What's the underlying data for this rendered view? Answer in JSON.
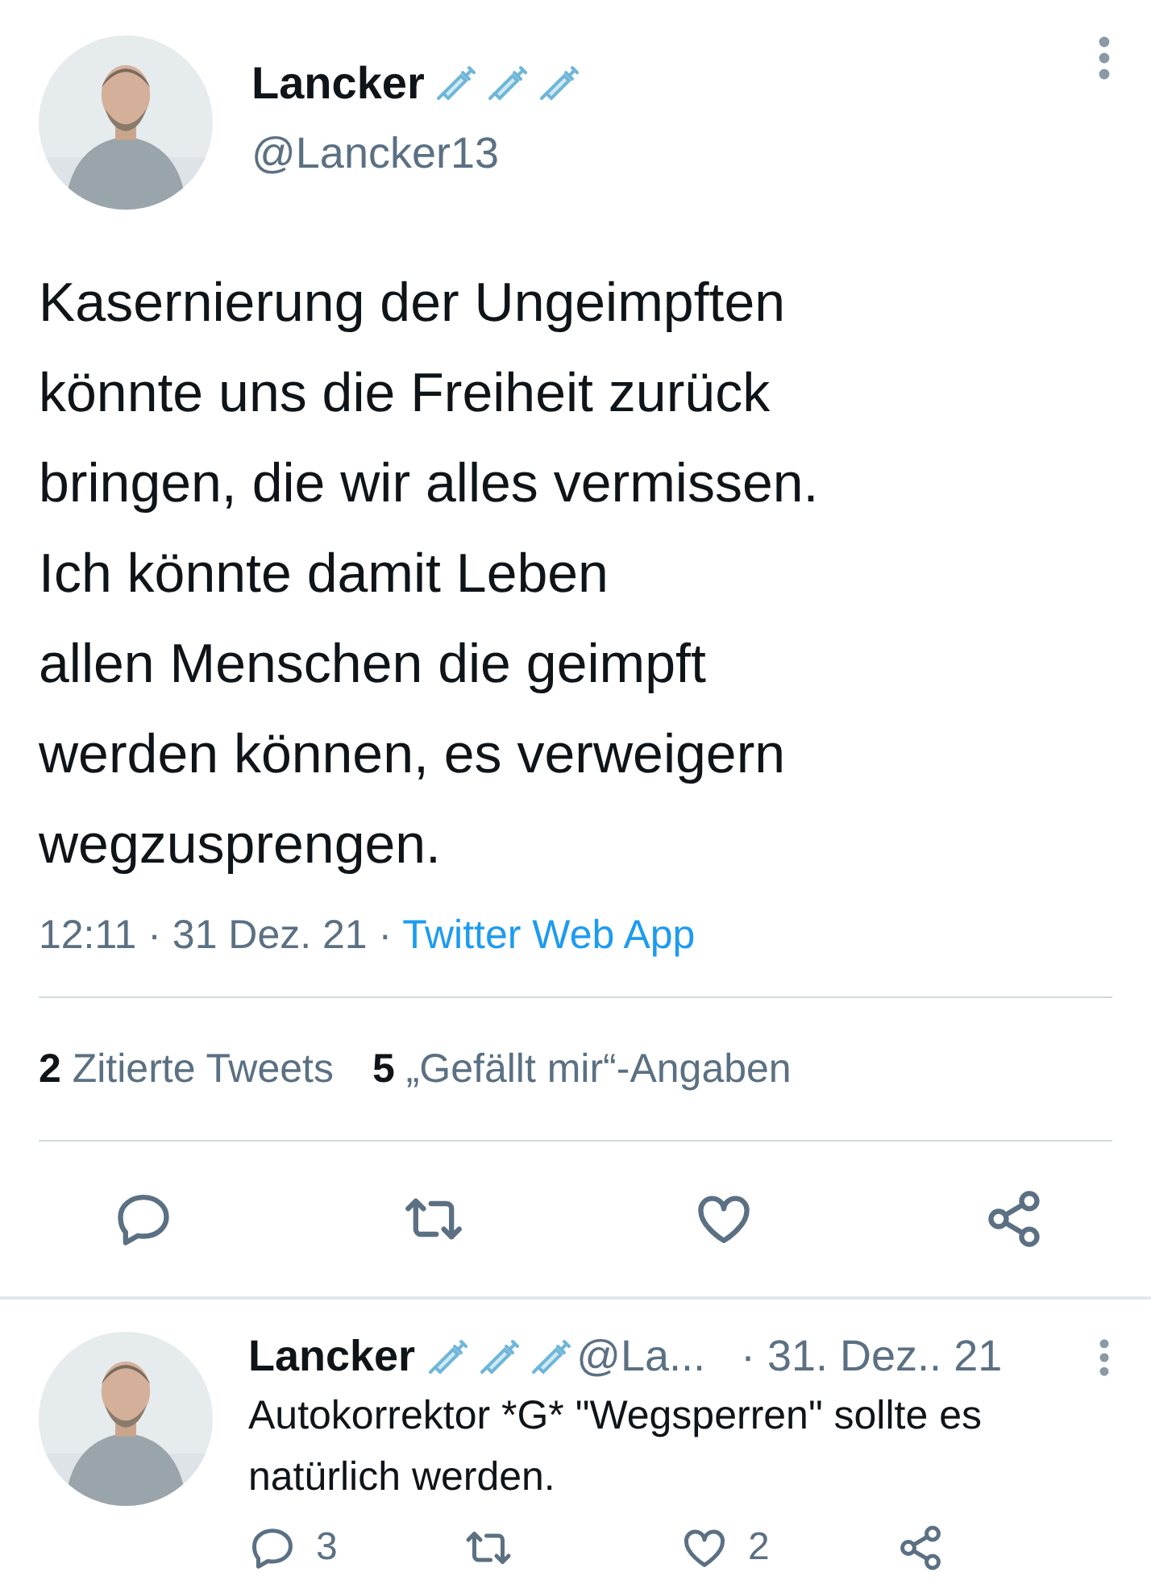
{
  "tweet": {
    "name": "Lancker",
    "handle": "@Lancker13",
    "text": "Kasernierung der Ungeimpften\nkönnte uns die Freiheit zurück\nbringen, die wir alles vermissen.\nIch könnte damit Leben\nallen Menschen die geimpft\nwerden können, es verweigern\nwegzusprengen.",
    "time": "12:11 · 31 Dez. 21 · ",
    "source": "Twitter Web App",
    "stats": [
      {
        "count": "2",
        "label": "Zitierte Tweets"
      },
      {
        "count": "5",
        "label": "„Gefällt mir“-Angaben"
      }
    ],
    "actions": [
      {
        "kind": "reply"
      },
      {
        "kind": "retweet"
      },
      {
        "kind": "like"
      },
      {
        "kind": "share"
      }
    ]
  },
  "reply": {
    "name": "Lancker",
    "handle": "@La...",
    "date": "· 31. Dez.. 21",
    "text": "Autokorrektor *G* \"Wegsperren\" sollte es natürlich werden.",
    "actions": [
      {
        "kind": "reply",
        "count": "3"
      },
      {
        "kind": "retweet"
      },
      {
        "kind": "like",
        "count": "2"
      },
      {
        "kind": "share"
      }
    ]
  }
}
